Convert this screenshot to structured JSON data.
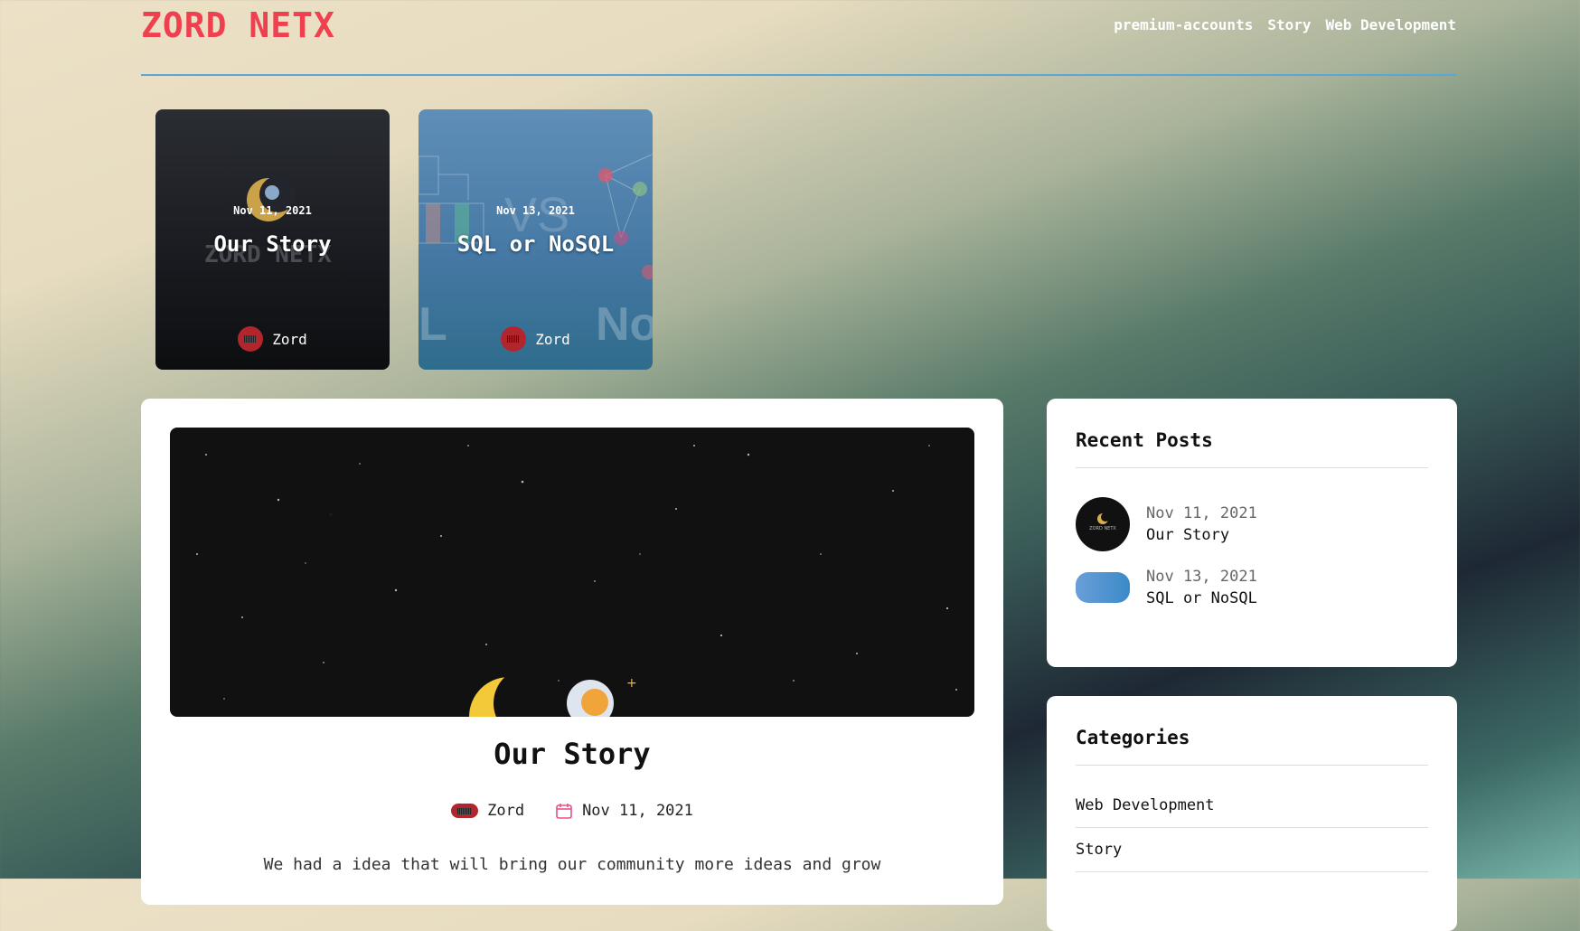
{
  "header": {
    "logo": "ZORD NETX",
    "nav": [
      "premium-accounts",
      "Story",
      "Web Development"
    ]
  },
  "featured": [
    {
      "date": "Nov 11, 2021",
      "title": "Our Story",
      "author": "Zord"
    },
    {
      "date": "Nov 13, 2021",
      "title": "SQL or NoSQL",
      "author": "Zord"
    }
  ],
  "post": {
    "title": "Our Story",
    "author": "Zord",
    "date": "Nov 11, 2021",
    "excerpt": "We had a idea that will bring our community more ideas and grow"
  },
  "recent": {
    "title": "Recent Posts",
    "items": [
      {
        "date": "Nov 11, 2021",
        "title": "Our Story"
      },
      {
        "date": "Nov 13, 2021",
        "title": "SQL or NoSQL"
      }
    ]
  },
  "categories": {
    "title": "Categories",
    "items": [
      "Web Development",
      "Story"
    ]
  },
  "colors": {
    "brand": "#f04050",
    "accent": "#5aa7d6"
  }
}
